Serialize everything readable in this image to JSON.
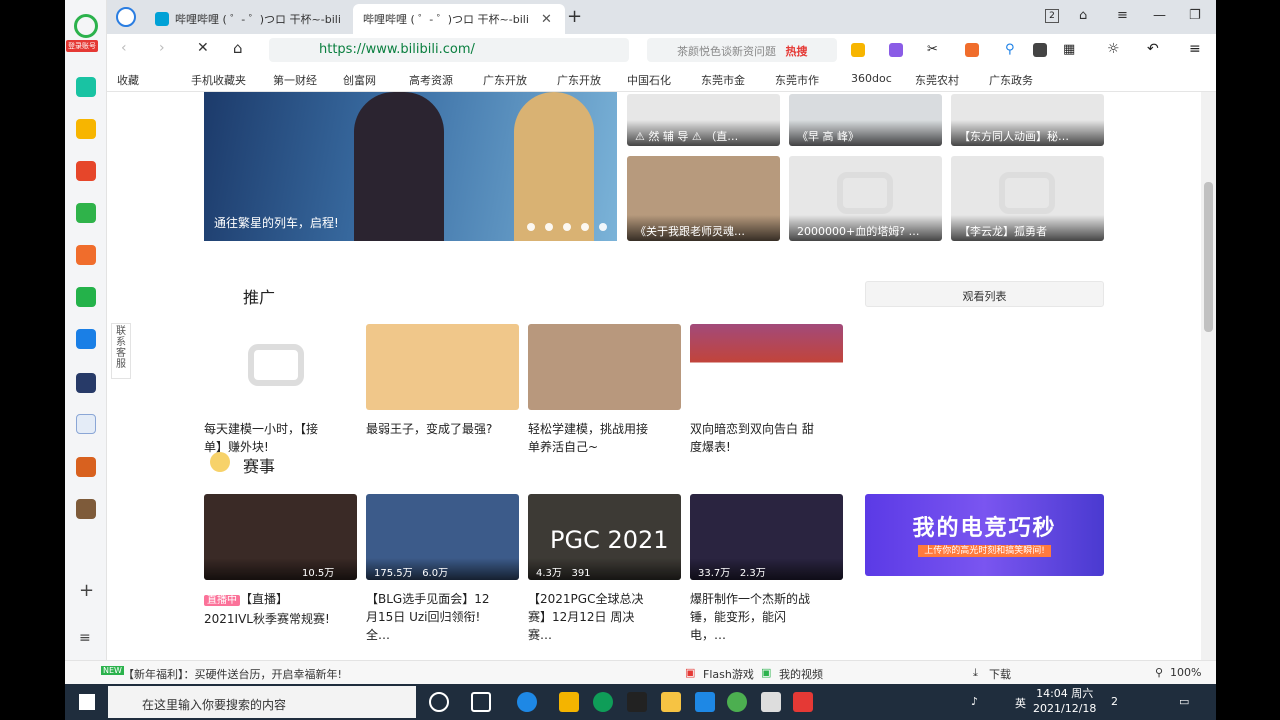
{
  "browser": {
    "login_badge": "登录账号",
    "tabs": [
      {
        "title": "哔哩哔哩 ( ゜- ゜)つロ 干杯~-bili",
        "active": false
      },
      {
        "title": "哔哩哔哩 ( ゜- ゜)つロ 干杯~-bili",
        "active": true
      }
    ],
    "new_tab": "+",
    "tab_count": "2",
    "url": "https://www.bilibili.com/",
    "search_placeholder": "茶颜悦色谈新资问题",
    "hot_search": "热搜",
    "bookmarks": [
      "收藏",
      "手机收藏夹",
      "第一财经",
      "创富网",
      "高考资源",
      "广东开放",
      "广东开放",
      "中国石化",
      "东莞市金",
      "东莞市作",
      "360doc",
      "东莞农村",
      "广东政务"
    ]
  },
  "page": {
    "banner_caption": "通往繁星的列车，启程!",
    "top_cards": [
      {
        "title": "⚠ 然 辅 导 ⚠ （直…"
      },
      {
        "title": "《早 高 峰》"
      },
      {
        "title": "【东方同人动画】秘…"
      },
      {
        "title": "《关于我跟老师灵魂…"
      },
      {
        "title": "2000000+血的塔姆? …"
      },
      {
        "title": "【李云龙】孤勇者"
      }
    ],
    "section_promo": "推广",
    "watch_list": "观看列表",
    "promo_videos": [
      {
        "title": "每天建模一小时，【接单】赚外块!"
      },
      {
        "title": "最弱王子，变成了最强?"
      },
      {
        "title": "轻松学建模，挑战用接单养活自己~"
      },
      {
        "title": "双向暗恋到双向告白 甜度爆表!"
      }
    ],
    "section_events": "赛事",
    "event_videos": [
      {
        "views": "10.5万",
        "likes": "",
        "title": "【直播】2021IVL秋季赛常规赛!",
        "live_tag": "直播中"
      },
      {
        "views": "175.5万",
        "likes": "6.0万",
        "title": "【BLG选手见面会】12月15日 Uzi回归领衔! 全…",
        "live_tag": ""
      },
      {
        "views": "4.3万",
        "likes": "391",
        "title": "【2021PGC全球总决赛】12月12日 周决赛…",
        "live_tag": ""
      },
      {
        "views": "33.7万",
        "likes": "2.3万",
        "title": "爆肝制作一个杰斯的战锤，能变形，能闪电，…",
        "live_tag": ""
      }
    ],
    "promo_banner": "我的电竞巧秒",
    "promo_banner_sub": "上传你的高光时刻和搞笑瞬间!",
    "side_help": "联系客服"
  },
  "status": {
    "news": "【新年福利】：买硬件送台历，开启幸福新年!",
    "flash": "Flash游戏",
    "my_video": "我的视频",
    "download": "下载",
    "zoom": "100%"
  },
  "taskbar": {
    "search_placeholder": "在这里输入你要搜索的内容",
    "time": "14:04 周六",
    "date": "2021/12/18",
    "lang": "英",
    "notif": "2"
  }
}
